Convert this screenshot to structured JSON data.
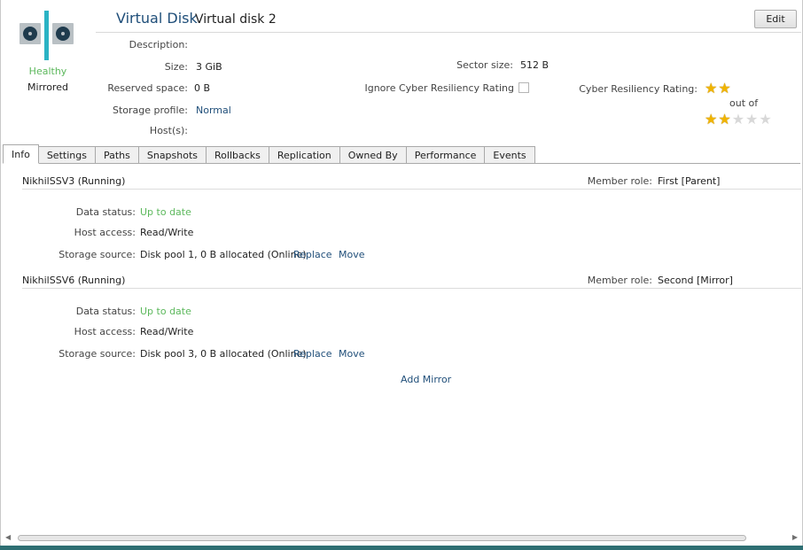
{
  "header": {
    "type_label": "Virtual Disk",
    "name": "Virtual disk 2",
    "edit_label": "Edit",
    "status_health": "Healthy",
    "status_mode": "Mirrored"
  },
  "properties": {
    "description_label": "Description:",
    "description_value": "",
    "size_label": "Size:",
    "size_value": "3 GiB",
    "reserved_label": "Reserved space:",
    "reserved_value": "0 B",
    "profile_label": "Storage profile:",
    "profile_value": "Normal",
    "hosts_label": "Host(s):",
    "hosts_value": "",
    "sector_label": "Sector size:",
    "sector_value": "512 B",
    "ignore_label": "Ignore Cyber Resiliency Rating",
    "ignore_checked": false,
    "rating_label": "Cyber Resiliency Rating:",
    "rating_out_of": "out of",
    "rating_value": 2,
    "rating_max": 5
  },
  "tabs": [
    {
      "label": "Info",
      "active": true
    },
    {
      "label": "Settings",
      "active": false
    },
    {
      "label": "Paths",
      "active": false
    },
    {
      "label": "Snapshots",
      "active": false
    },
    {
      "label": "Rollbacks",
      "active": false
    },
    {
      "label": "Replication",
      "active": false
    },
    {
      "label": "Owned By",
      "active": false
    },
    {
      "label": "Performance",
      "active": false
    },
    {
      "label": "Events",
      "active": false
    }
  ],
  "servers": [
    {
      "name": "NikhilSSV3 (Running)",
      "role_label": "Member role:",
      "role_value": "First [Parent]",
      "data_status_label": "Data status:",
      "data_status_value": "Up to date",
      "host_access_label": "Host access:",
      "host_access_value": "Read/Write",
      "storage_label": "Storage source:",
      "storage_value": "Disk pool 1, 0 B allocated (Online)",
      "replace_label": "Replace",
      "move_label": "Move"
    },
    {
      "name": "NikhilSSV6 (Running)",
      "role_label": "Member role:",
      "role_value": "Second [Mirror]",
      "data_status_label": "Data status:",
      "data_status_value": "Up to date",
      "host_access_label": "Host access:",
      "host_access_value": "Read/Write",
      "storage_label": "Storage source:",
      "storage_value": "Disk pool 3, 0 B allocated (Online)",
      "replace_label": "Replace",
      "move_label": "Move"
    }
  ],
  "add_mirror_label": "Add Mirror",
  "icons": {
    "logo": "mirrored-disk-icon",
    "star": "star-icon",
    "scroll_left": "scroll-left-arrow-icon",
    "scroll_right": "scroll-right-arrow-icon"
  },
  "colors": {
    "healthy": "#5cb85c",
    "link": "#1f4e79",
    "accent": "#2ab3c4",
    "star_on": "#f0b400"
  }
}
